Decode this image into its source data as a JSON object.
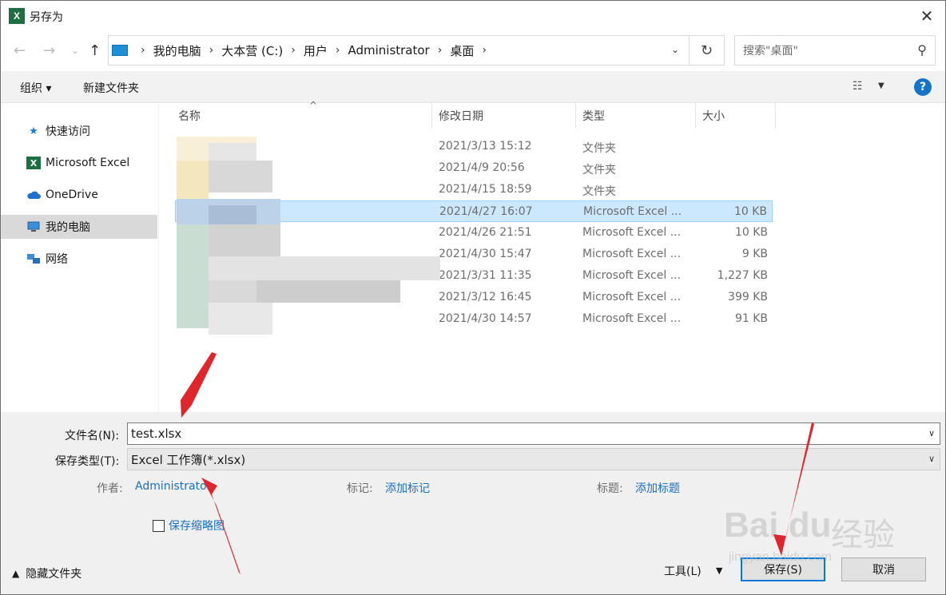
{
  "window": {
    "title": "另存为",
    "app_icon": "X",
    "close": "✕"
  },
  "nav": {
    "back": "←",
    "forward": "→",
    "recent": "⌄",
    "up": "↑",
    "breadcrumbs": [
      "我的电脑",
      "大本营 (C:)",
      "用户",
      "Administrator",
      "桌面"
    ],
    "refresh": "↻",
    "search_placeholder": "搜索\"桌面\""
  },
  "toolbar": {
    "organize": "组织 ▾",
    "new_folder": "新建文件夹",
    "view": "☷",
    "help": "?"
  },
  "sidebar": {
    "items": [
      {
        "label": "快速访问",
        "icon": "star-icon"
      },
      {
        "label": "Microsoft Excel",
        "icon": "excel-icon"
      },
      {
        "label": "OneDrive",
        "icon": "cloud-icon"
      },
      {
        "label": "我的电脑",
        "icon": "computer-icon",
        "selected": true
      },
      {
        "label": "网络",
        "icon": "network-icon"
      }
    ]
  },
  "file_list": {
    "columns": [
      "名称",
      "修改日期",
      "类型",
      "大小"
    ],
    "rows": [
      {
        "date": "2021/3/13 15:12",
        "type": "文件夹",
        "size": ""
      },
      {
        "date": "2021/4/9 20:56",
        "type": "文件夹",
        "size": ""
      },
      {
        "date": "2021/4/15 18:59",
        "type": "文件夹",
        "size": ""
      },
      {
        "date": "2021/4/27 16:07",
        "type": "Microsoft Excel ...",
        "size": "10 KB",
        "selected": true
      },
      {
        "date": "2021/4/26 21:51",
        "type": "Microsoft Excel ...",
        "size": "10 KB"
      },
      {
        "date": "2021/4/30 15:47",
        "type": "Microsoft Excel ...",
        "size": "9 KB"
      },
      {
        "date": "2021/3/31 11:35",
        "type": "Microsoft Excel ...",
        "size": "1,227 KB"
      },
      {
        "date": "2021/3/12 16:45",
        "type": "Microsoft Excel ...",
        "size": "399 KB"
      },
      {
        "date": "2021/4/30 14:57",
        "type": "Microsoft Excel ...",
        "size": "91 KB"
      }
    ]
  },
  "form": {
    "filename_label": "文件名(N):",
    "filename_value": "test.xlsx",
    "filetype_label": "保存类型(T):",
    "filetype_value": "Excel 工作簿(*.xlsx)",
    "author_label": "作者:",
    "author_value": "Administrator",
    "tags_label": "标记:",
    "tags_value": "添加标记",
    "title_label": "标题:",
    "title_value": "添加标题",
    "thumbnail_label": "保存缩略图",
    "hide_folders": "隐藏文件夹",
    "tools": "工具(L)",
    "save": "保存(S)",
    "cancel": "取消"
  },
  "watermark": {
    "brand": "Bai du",
    "cn": "经验",
    "url": "jingyan.baidu.com"
  },
  "colors": {
    "accent": "#0078d7",
    "link": "#1d6fbf",
    "selected_row": "#cce8ff",
    "arrow": "#e0262d"
  }
}
